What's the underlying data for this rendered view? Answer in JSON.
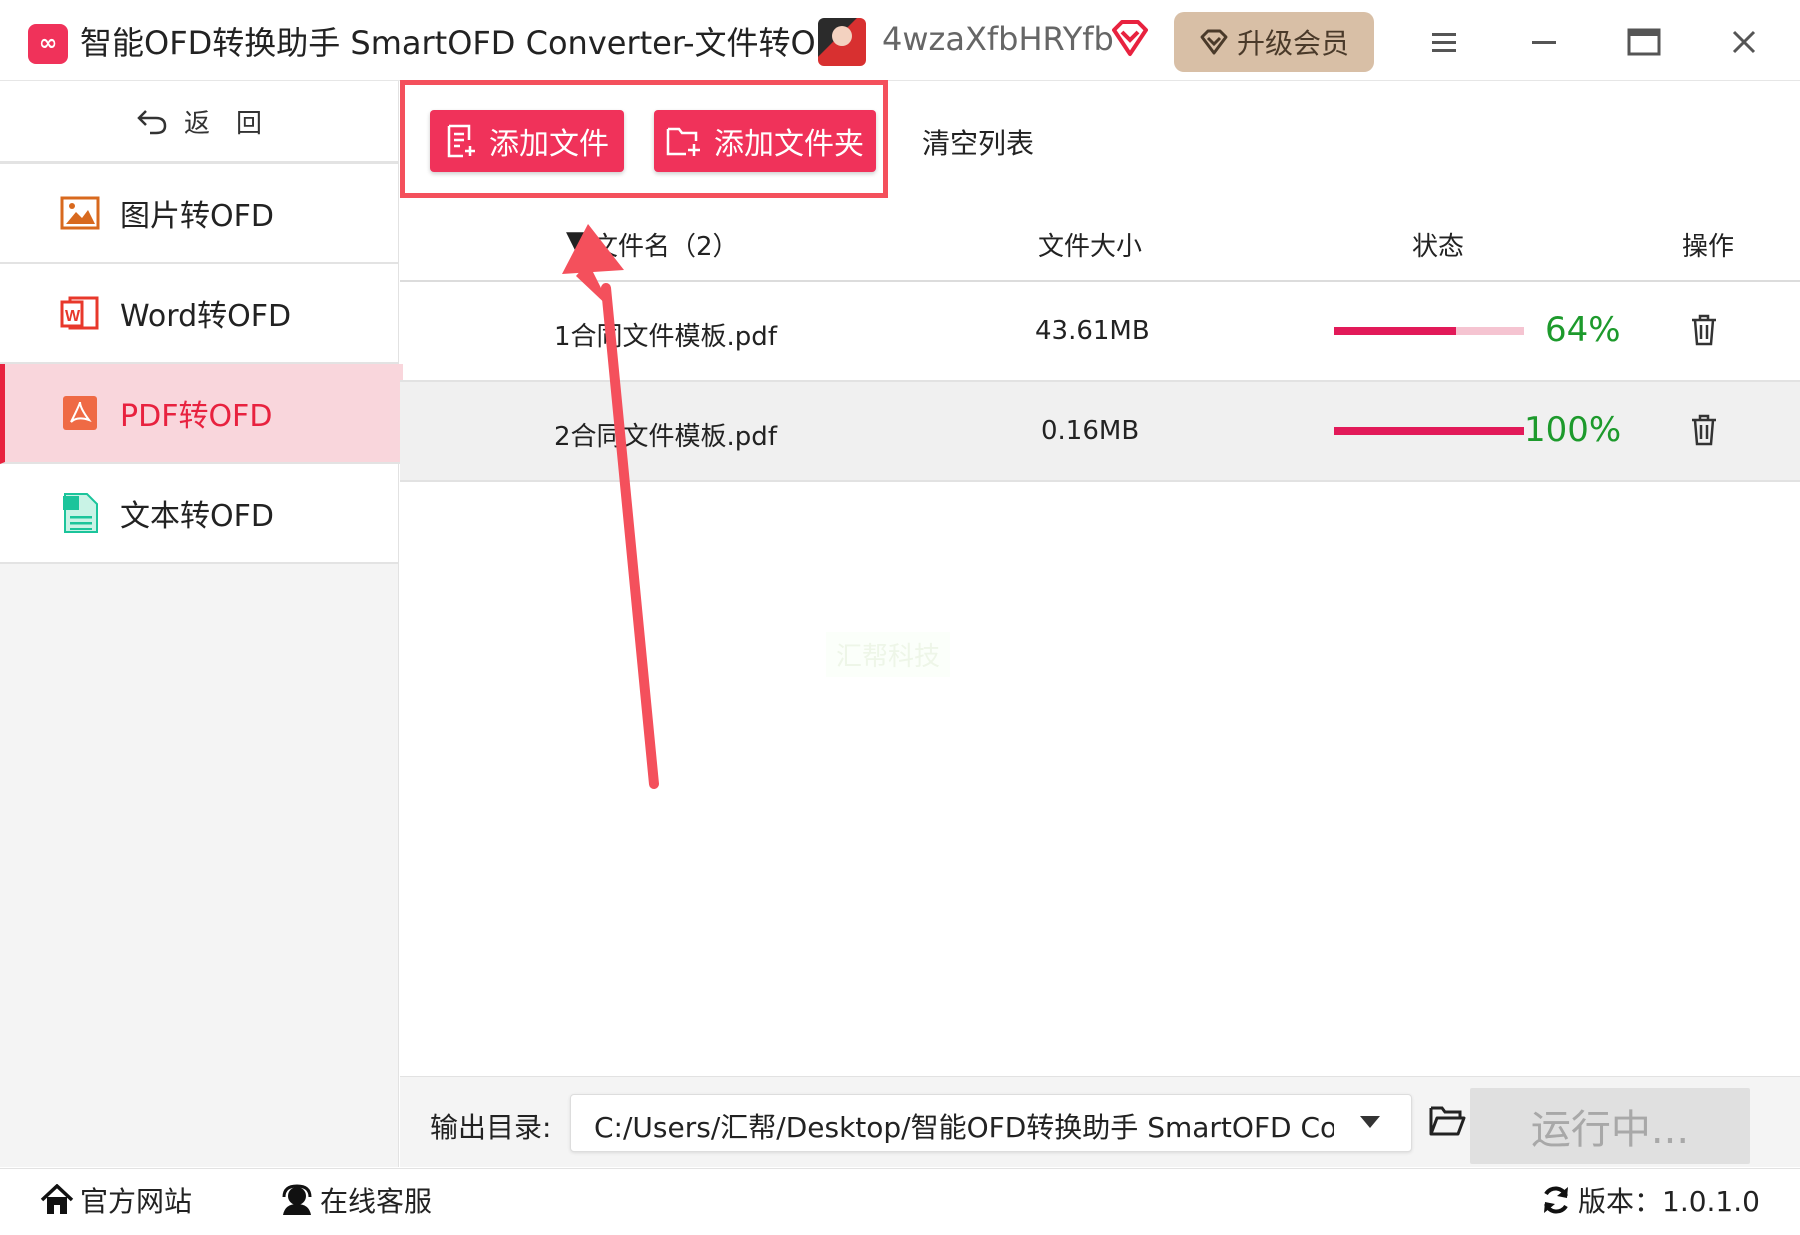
{
  "titlebar": {
    "logo": "OFD",
    "title": "智能OFD转换助手 SmartOFD Converter-文件转OFD",
    "username": "4wzaXfbHRYfb",
    "upgrade_label": "升级会员"
  },
  "sidebar": {
    "back_label": "返　回",
    "items": [
      {
        "label": "图片转OFD",
        "icon": "image-icon",
        "color": "#d8691e"
      },
      {
        "label": "Word转OFD",
        "icon": "word-icon",
        "color": "#e8382b"
      },
      {
        "label": "PDF转OFD",
        "icon": "pdf-icon",
        "color": "#ef6a45"
      },
      {
        "label": "文本转OFD",
        "icon": "text-doc-icon",
        "color": "#1bc49b"
      }
    ],
    "active_index": 2
  },
  "toolbar": {
    "add_file_label": "添加文件",
    "add_folder_label": "添加文件夹",
    "clear_label": "清空列表"
  },
  "table": {
    "headers": {
      "name": "文件名（2）",
      "size": "文件大小",
      "status": "状态",
      "action": "操作"
    },
    "rows": [
      {
        "name": "1合同文件模板.pdf",
        "size": "43.61MB",
        "progress": 0.64,
        "percent": "64%"
      },
      {
        "name": "2合同文件模板.pdf",
        "size": "0.16MB",
        "progress": 1.0,
        "percent": "100%"
      }
    ]
  },
  "watermark": "汇帮科技",
  "output": {
    "label": "输出目录:",
    "path": "C:/Users/汇帮/Desktop/智能OFD转换助手 SmartOFD Converter"
  },
  "run_label": "运行中...",
  "footer": {
    "website_label": "官方网站",
    "support_label": "在线客服",
    "version_label": "版本：1.0.1.0"
  },
  "colors": {
    "accent": "#f0325a",
    "progress": "#e21a59",
    "percent": "#1d9a2c",
    "annotation": "#f4505c"
  }
}
